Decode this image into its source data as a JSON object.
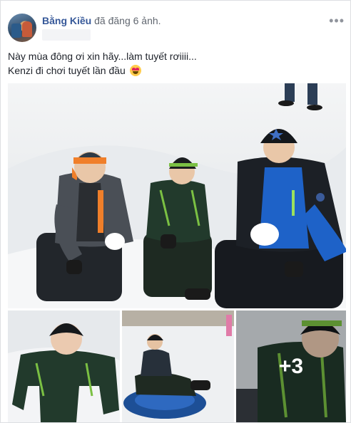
{
  "post": {
    "author": "Bằng Kiều",
    "action": " đã đăng 6 ảnh.",
    "more_label": "•••",
    "text_line1": "Này mùa đông ơi xin hãy...làm tuyết rơiiii...",
    "text_line2": "Kenzi đi chơi tuyết lần đầu",
    "emoji": "smiling-face-with-heart-eyes",
    "extra_photos_label": "+3"
  },
  "colors": {
    "author_link": "#365899",
    "snow": "#eef0f2",
    "jacket_green": "#1f3a2a",
    "jacket_blue": "#1e62c8",
    "accent_orange": "#f07f2a"
  }
}
